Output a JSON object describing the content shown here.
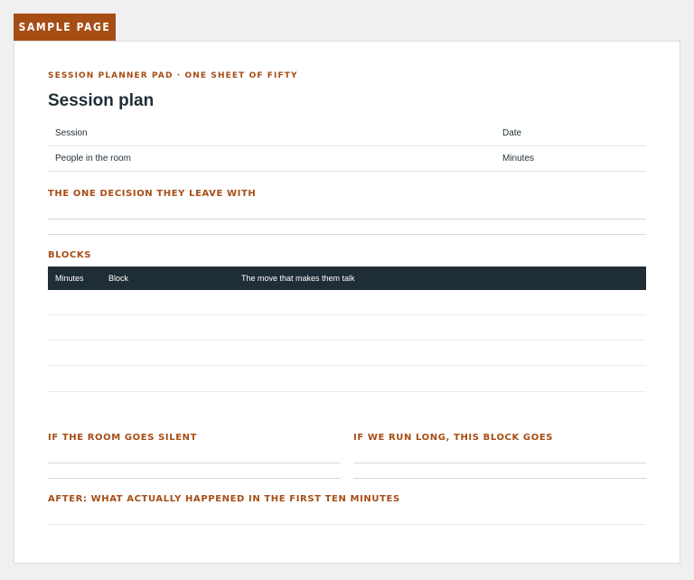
{
  "tab_label": "SAMPLE PAGE",
  "pad_label": "SESSION PLANNER PAD · ONE SHEET OF FIFTY",
  "title": "Session plan",
  "meta_rows": [
    {
      "left": "Session",
      "right": "Date"
    },
    {
      "left": "People in the room",
      "right": "Minutes"
    }
  ],
  "sections": {
    "decision": "THE ONE DECISION THEY LEAVE WITH",
    "blocks": "BLOCKS",
    "silent": "IF THE ROOM GOES SILENT",
    "run_long": "IF WE RUN LONG, THIS BLOCK GOES",
    "after": "AFTER: WHAT ACTUALLY HAPPENED IN THE FIRST TEN MINUTES"
  },
  "blocks_table": {
    "columns": [
      "Minutes",
      "Block",
      "The move that makes them talk"
    ]
  },
  "colors": {
    "accent": "#a64d14",
    "dark": "#1f2d36",
    "background": "#f0f0f0"
  }
}
